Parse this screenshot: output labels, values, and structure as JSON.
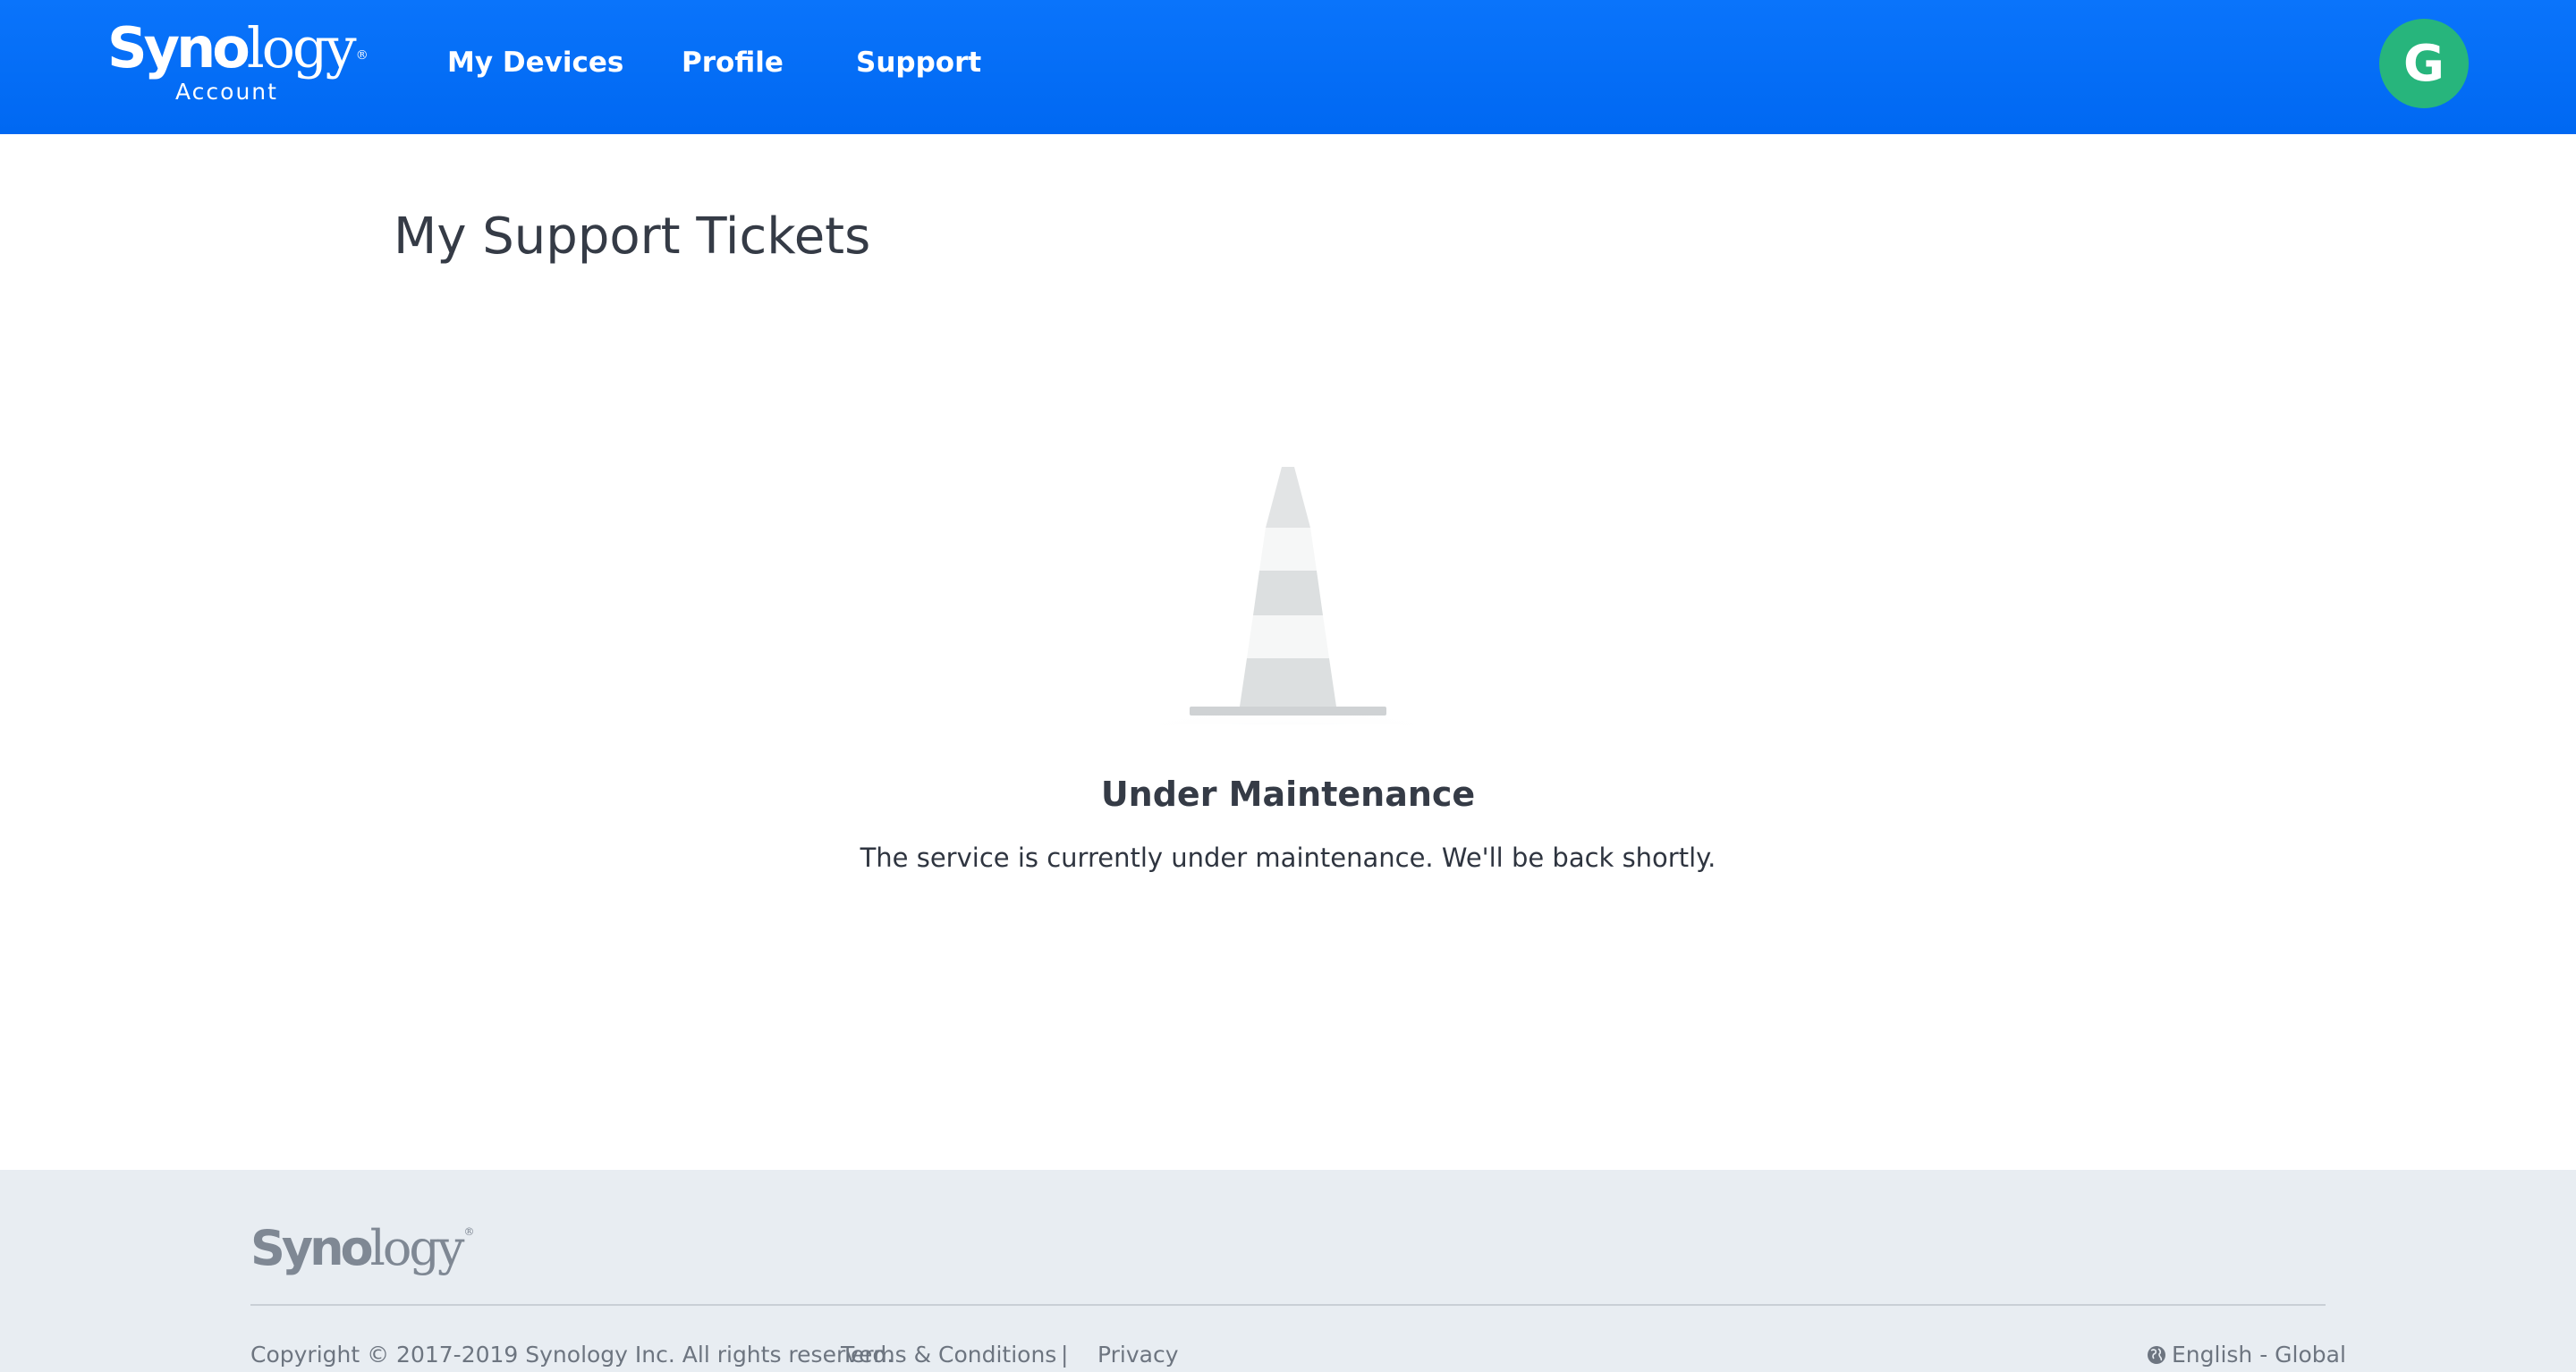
{
  "header": {
    "brand": {
      "word_bold": "Syno",
      "word_light": "logy",
      "reg": "®",
      "sub": "Account"
    },
    "nav": [
      {
        "label": "My Devices"
      },
      {
        "label": "Profile"
      },
      {
        "label": "Support"
      }
    ],
    "avatar_initial": "G"
  },
  "main": {
    "title": "My Support Tickets",
    "status_title": "Under Maintenance",
    "status_text": "The service is currently under maintenance. We'll be back shortly.",
    "illustration": "traffic-cone-icon"
  },
  "footer": {
    "brand": {
      "word_bold": "Syno",
      "word_light": "logy",
      "reg": "®"
    },
    "copyright": "Copyright © 2017-2019 Synology Inc. All rights reserved.",
    "terms": "Terms & Conditions",
    "separator": "|",
    "privacy": "Privacy",
    "language": "English - Global",
    "language_icon": "globe-icon"
  },
  "colors": {
    "header": "#0a74fb",
    "avatar": "#27b57c",
    "footer_bg": "#e8edf2"
  }
}
